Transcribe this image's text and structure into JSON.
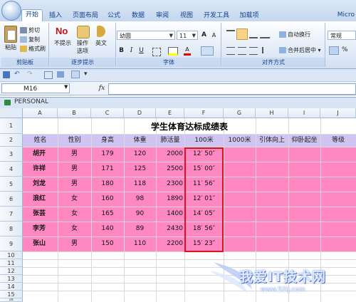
{
  "ribbon_tabs": [
    "开始",
    "插入",
    "页面布局",
    "公式",
    "数据",
    "审阅",
    "视图",
    "开发工具",
    "加载项"
  ],
  "corner_text": "Micro",
  "clipboard": {
    "paste": "粘贴",
    "cut": "剪切",
    "copy": "复制",
    "format_painter": "格式刷",
    "label": "剪贴板"
  },
  "steps": {
    "no_prompt": "不提示",
    "operation": "操作选项",
    "english": "英文",
    "no_label_big": "No",
    "label": "逐步提示"
  },
  "font": {
    "name": "幼圆",
    "size": "11",
    "grow": "A",
    "shrink": "A",
    "bold": "B",
    "italic": "I",
    "underline": "U",
    "label": "字体"
  },
  "alignment": {
    "wrap": "自动换行",
    "merge": "合并后居中",
    "label": "对齐方式"
  },
  "number": {
    "format": "常规"
  },
  "name_box": "M16",
  "fx": "fx",
  "formula": "",
  "workbook_title": "PERSONAL",
  "columns": [
    "A",
    "B",
    "C",
    "D",
    "E",
    "F",
    "G",
    "H",
    "I",
    "J"
  ],
  "rows": [
    "1",
    "2",
    "3",
    "4",
    "5",
    "6",
    "7",
    "8",
    "9",
    "10",
    "11",
    "12",
    "13",
    "14",
    "15",
    "16"
  ],
  "sheet": {
    "title": "学生体育达标成绩表",
    "headers": [
      "姓名",
      "性别",
      "身高",
      "体重",
      "肺活量",
      "100米",
      "1000米",
      "引体向上",
      "仰卧起坐",
      "等级"
    ],
    "records": [
      [
        "胡开",
        "男",
        "179",
        "120",
        "2000",
        "12′ 50″"
      ],
      [
        "许祥",
        "男",
        "171",
        "125",
        "2500",
        "15′ 00″"
      ],
      [
        "刘龙",
        "男",
        "180",
        "118",
        "2300",
        "11′ 56″"
      ],
      [
        "浪红",
        "女",
        "160",
        "98",
        "1890",
        "12′ 01″"
      ],
      [
        "张芸",
        "女",
        "165",
        "90",
        "1400",
        "14′ 05″"
      ],
      [
        "李芳",
        "女",
        "140",
        "89",
        "2430",
        "18′ 56″"
      ],
      [
        "张山",
        "男",
        "150",
        "110",
        "2200",
        "15′ 23″"
      ]
    ]
  },
  "watermark": {
    "text": "我爱IT技术网",
    "url": "www.52ij.com"
  },
  "colors": {
    "pink": "#ff88c2",
    "lilac": "#cfc4f2",
    "highlight_border": "#d8141f"
  }
}
